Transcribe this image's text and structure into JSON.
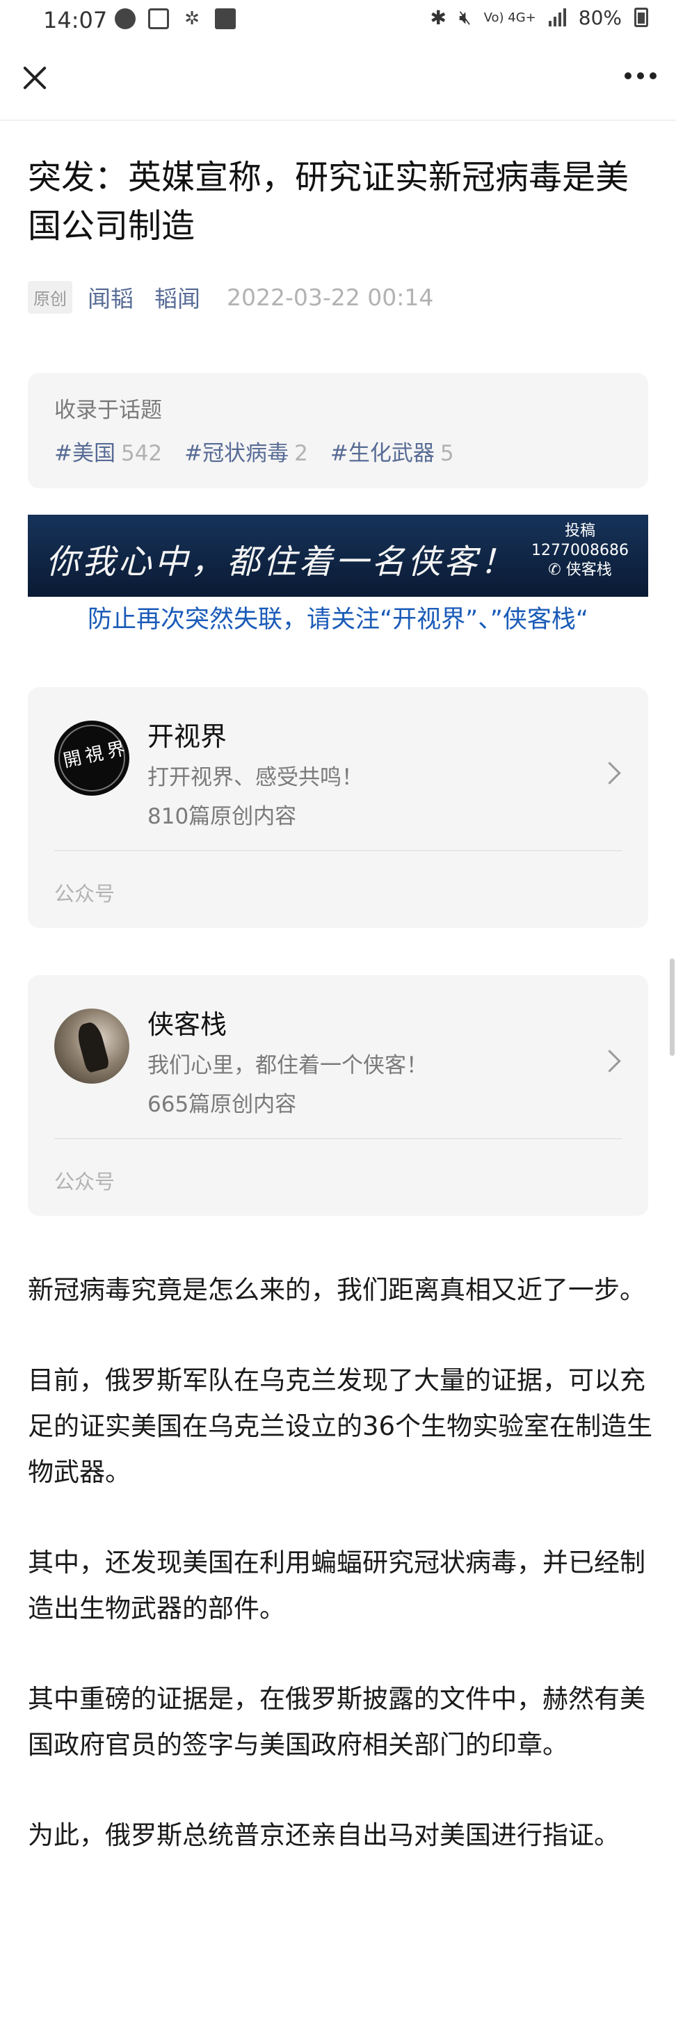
{
  "status_bar": {
    "time": "14:07",
    "network": "Vo) 4G+",
    "battery": "80%"
  },
  "article": {
    "title": "突发：英媒宣称，研究证实新冠病毒是美国公司制造",
    "badge": "原创",
    "author1": "闻韬",
    "author2": "韬闻",
    "date": "2022-03-22 00:14"
  },
  "topics": {
    "heading": "收录于话题",
    "items": [
      {
        "name": "#美国",
        "count": "542"
      },
      {
        "name": "#冠状病毒",
        "count": "2"
      },
      {
        "name": "#生化武器",
        "count": "5"
      }
    ]
  },
  "banner": {
    "text": "你我心中，都住着一名侠客！",
    "side_line1": "投稿",
    "side_line2": "1277008686",
    "side_line3": "侠客栈"
  },
  "follow_note": "防止再次突然失联，请关注“开视界”、”侠客栈“",
  "accounts": [
    {
      "name": "开视界",
      "desc": "打开视界、感受共鸣！",
      "count": "810篇原创内容",
      "type": "公众号",
      "avatar_text": "開視界"
    },
    {
      "name": "侠客栈",
      "desc": "我们心里，都住着一个侠客！",
      "count": "665篇原创内容",
      "type": "公众号"
    }
  ],
  "paragraphs": [
    "新冠病毒究竟是怎么来的，我们距离真相又近了一步。",
    "目前，俄罗斯军队在乌克兰发现了大量的证据，可以充足的证实美国在乌克兰设立的36个生物实验室在制造生物武器。",
    "其中，还发现美国在利用蝙蝠研究冠状病毒，并已经制造出生物武器的部件。",
    "其中重磅的证据是，在俄罗斯披露的文件中，赫然有美国政府官员的签字与美国政府相关部门的印章。",
    "为此，俄罗斯总统普京还亲自出马对美国进行指证。"
  ]
}
